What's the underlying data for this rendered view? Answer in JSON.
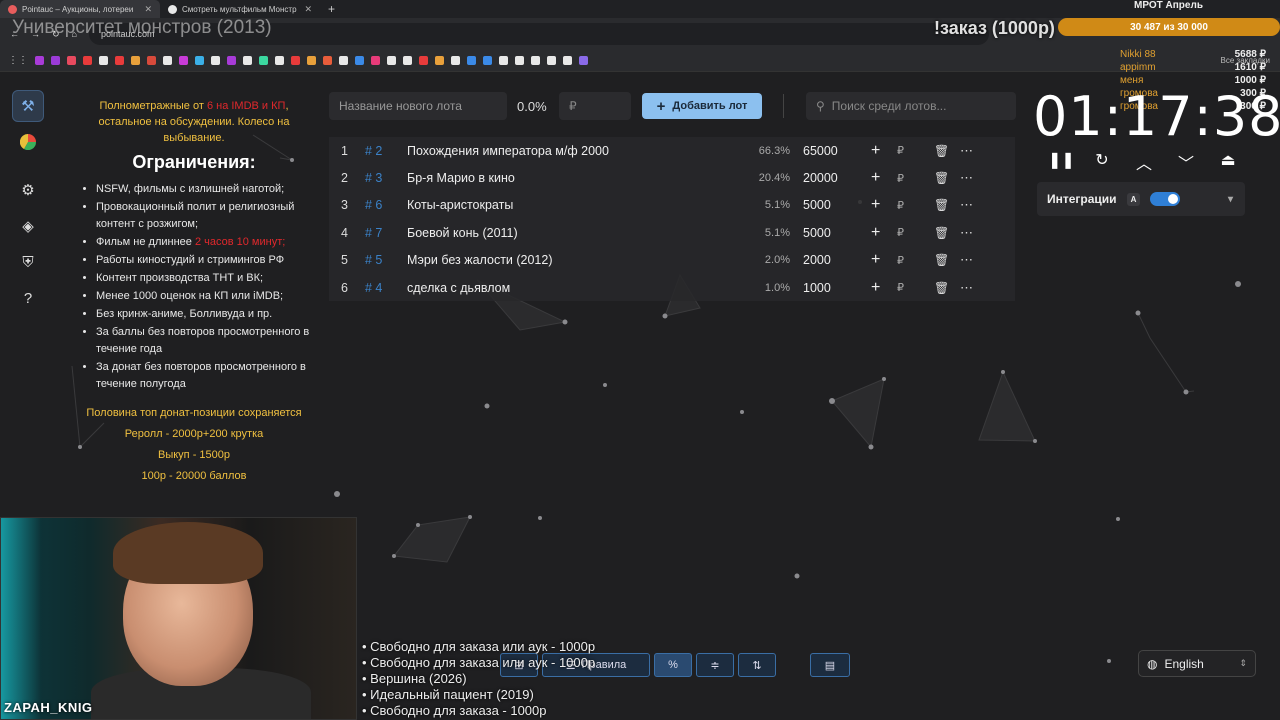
{
  "browser": {
    "tabs": [
      {
        "label": "Pointauc – Аукционы, лотереи",
        "active": true
      },
      {
        "label": "Смотреть мультфильм Монстр",
        "active": false
      }
    ],
    "url": "pointauc.com",
    "bookmarks_all": "Все закладки",
    "bookmark_colors": [
      "#a83bd8",
      "#9b3bd8",
      "#e84a5f",
      "#e83b3b",
      "#e8e8e8",
      "#e83b3b",
      "#e8a03b",
      "#d84a3b",
      "#e8e8e8",
      "#c83bd8",
      "#3bb0e8",
      "#e8e8e8",
      "#a83bd8",
      "#e8e8e8",
      "#3bd8a0",
      "#e8e8e8",
      "#e83b3b",
      "#e8a03b",
      "#e85d3b",
      "#e8e8e8",
      "#3b8ae8",
      "#e83b7a",
      "#e8e8e8",
      "#e8e8e8",
      "#e83b3b",
      "#e8a03b",
      "#e8e8e8",
      "#3b8ae8",
      "#3b8ae8",
      "#e8e8e8",
      "#e8e8e8",
      "#e8e8e8",
      "#e8e8e8",
      "#e8e8e8",
      "#8a6ae8"
    ]
  },
  "stream": {
    "title": "Университет монстров (2013)",
    "zakaz": "!заказ (1000р)",
    "mrot": {
      "title": "МРОТ Апрель",
      "progress_text": "30 487 из 30 000"
    },
    "donors": [
      "Nikki 88",
      "appimm",
      "меня",
      "громова",
      "громова"
    ],
    "donor_amounts": [
      "5688 ₽",
      "1610 ₽",
      "1000 ₽",
      "300 ₽",
      "300 ₽"
    ],
    "nickname": "ZAPAH_KNIG",
    "orders": [
      "• Свободно для заказа или аук - 1000р",
      "• Свободно для заказа или аук - 1000р",
      "• Вершина (2026)",
      "• Идеальный пациент (2019)",
      "• Свободно для заказа - 1000р"
    ]
  },
  "sidebar": {
    "items": [
      "gavel-icon",
      "wheel-icon",
      "settings-icon",
      "layers-icon",
      "shield-icon",
      "help-icon"
    ]
  },
  "rules": {
    "intro_a": "Полнометражные от ",
    "intro_red": "6 на IMDB и КП",
    "intro_b": ", остальное на обсуждении. Колесо на выбывание.",
    "heading": "Ограничения:",
    "items": [
      "NSFW, фильмы с излишней наготой;",
      "Провокационный полит и религиозный контент с розжигом;",
      "Фильм не длиннее ",
      "Работы киностудий и стримингов РФ",
      "Контент производства ТНТ и ВК;",
      "Менее 1000 оценок на КП или iMDB;",
      "Без кринж-аниме, Болливуда и пр.",
      "За баллы без повторов просмотренного в течение года",
      "За донат без повторов просмотренного в течение полугода"
    ],
    "item3_red": "2 часов 10 минут;",
    "gold_lines": [
      "Половина топ донат-позиции сохраняется",
      "Реролл - 2000р+200 крутка",
      "Выкуп - 1500р",
      "100р - 20000 баллов"
    ]
  },
  "toolbar": {
    "lot_placeholder": "Название нового лота",
    "percent": "0.0%",
    "rub_placeholder": "₽",
    "add_label": "Добавить лот",
    "search_placeholder": "Поиск среди лотов..."
  },
  "lots": [
    {
      "index": "1",
      "num": "# 2",
      "name": "Похождения императора м/ф 2000",
      "percent": "66.3%",
      "amount": "65000"
    },
    {
      "index": "2",
      "num": "# 3",
      "name": "Бр-я Марио в кино",
      "percent": "20.4%",
      "amount": "20000"
    },
    {
      "index": "3",
      "num": "# 6",
      "name": "Коты-аристократы",
      "percent": "5.1%",
      "amount": "5000"
    },
    {
      "index": "4",
      "num": "# 7",
      "name": "Боевой конь (2011)",
      "percent": "5.1%",
      "amount": "5000"
    },
    {
      "index": "5",
      "num": "# 5",
      "name": "Мэри без жалости (2012)",
      "percent": "2.0%",
      "amount": "2000"
    },
    {
      "index": "6",
      "num": "# 4",
      "name": "сделка с дьявлом",
      "percent": "1.0%",
      "amount": "1000"
    }
  ],
  "timer": {
    "value": "01:17:38",
    "integrations_label": "Интеграции",
    "integrations_badge": "A",
    "integrations_enabled": true
  },
  "bottom": {
    "rules_label": "Правила",
    "language": "English"
  },
  "colors": {
    "accent": "#8cc0ef",
    "lot_number": "#3b82c8",
    "gold": "#f0c040",
    "red": "#e0282c",
    "mrot_bar": "#d08a16"
  }
}
